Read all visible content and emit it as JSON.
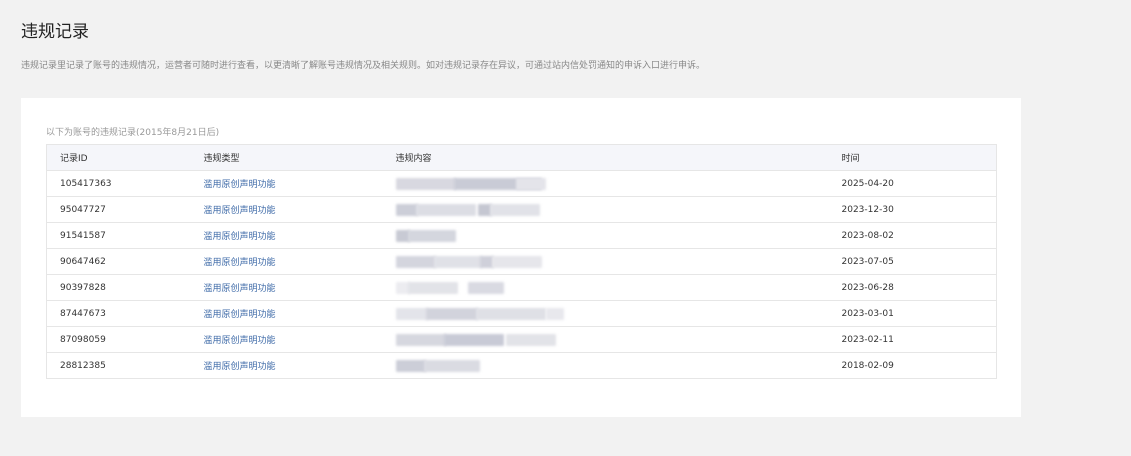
{
  "page": {
    "title": "违规记录",
    "description": "违规记录里记录了账号的违规情况，运营者可随时进行查看，以更清晰了解账号违规情况及相关规则。如对违规记录存在异议，可通过站内信处罚通知的申诉入口进行申诉。"
  },
  "table": {
    "caption": "以下为账号的违规记录(2015年8月21日后)",
    "headers": [
      "记录ID",
      "违规类型",
      "违规内容",
      "时间"
    ],
    "rows": [
      {
        "id": "105417363",
        "type": "滥用原创声明功能",
        "content_redacted": true,
        "time": "2025-04-20"
      },
      {
        "id": "95047727",
        "type": "滥用原创声明功能",
        "content_redacted": true,
        "time": "2023-12-30"
      },
      {
        "id": "91541587",
        "type": "滥用原创声明功能",
        "content_redacted": true,
        "time": "2023-08-02"
      },
      {
        "id": "90647462",
        "type": "滥用原创声明功能",
        "content_redacted": true,
        "time": "2023-07-05"
      },
      {
        "id": "90397828",
        "type": "滥用原创声明功能",
        "content_redacted": true,
        "time": "2023-06-28"
      },
      {
        "id": "87447673",
        "type": "滥用原创声明功能",
        "content_redacted": true,
        "time": "2023-03-01"
      },
      {
        "id": "87098059",
        "type": "滥用原创声明功能",
        "content_redacted": true,
        "time": "2023-02-11"
      },
      {
        "id": "28812385",
        "type": "滥用原创声明功能",
        "content_redacted": true,
        "time": "2018-02-09"
      }
    ]
  },
  "colors": {
    "page_bg": "#f2f2f2",
    "card_bg": "#ffffff",
    "header_bg": "#f5f6fa",
    "type_link": "#3f6ba8"
  }
}
